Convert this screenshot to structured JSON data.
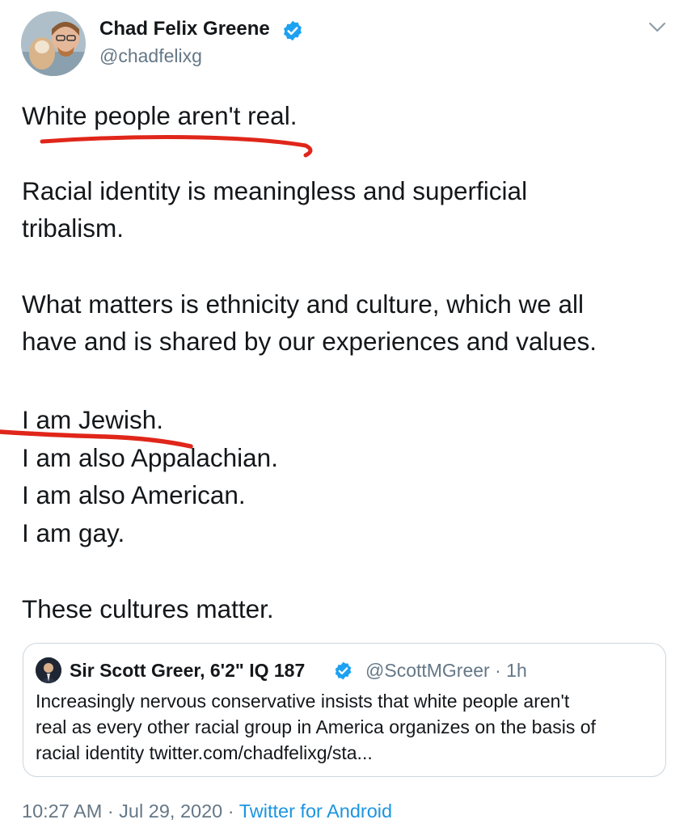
{
  "author": {
    "name": "Chad Felix Greene",
    "handle": "@chadfelixg",
    "verified": true
  },
  "tweet": {
    "lines": [
      "White people aren't real.",
      "Racial identity is meaningless and superficial",
      "tribalism.",
      "What matters is ethnicity and culture, which we all",
      "have and is shared by our experiences and values.",
      "I am Jewish.",
      "I am also Appalachian.",
      "I am also American.",
      "I am gay.",
      "These cultures matter."
    ]
  },
  "quoted_tweet": {
    "name": "Sir Scott Greer, 6'2\" IQ 187",
    "handle_time": "@ScottMGreer · 1h",
    "lines": [
      "Increasingly nervous conservative insists that white people aren't",
      "real as every other racial group in America organizes on the basis of",
      "racial identity twitter.com/chadfelixg/sta..."
    ]
  },
  "meta": {
    "timestamp": "10:27 AM · Jul 29, 2020 · ",
    "source": "Twitter for Android"
  },
  "colors": {
    "verified": "#1da1f2",
    "link": "#1b95e0",
    "secondary": "#657786",
    "annotation": "#e0261a"
  },
  "icons": {
    "menu": "chevron-down-icon",
    "verified": "verified-badge-icon"
  }
}
